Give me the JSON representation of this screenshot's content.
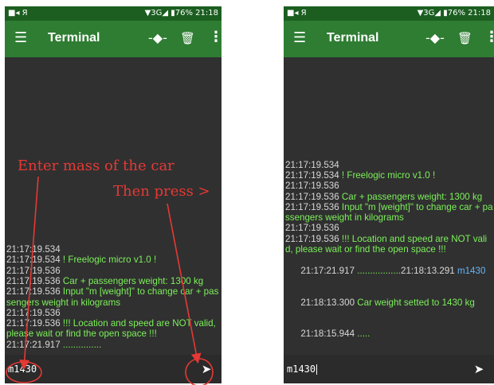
{
  "left": {
    "status_left": "■◂  Я",
    "status_right": "▼3G◢ ▮76% 21:18",
    "title": "Terminal",
    "log": [
      {
        "ts": "21:17:19.534",
        "msg": ""
      },
      {
        "ts": "21:17:19.534",
        "msg": " ! Freelogic micro v1.0 !"
      },
      {
        "ts": "21:17:19.536",
        "msg": ""
      },
      {
        "ts": "21:17:19.536",
        "msg": " Car + passengers weight: 1300 kg"
      },
      {
        "ts": "21:17:19.536",
        "msg": " Input \"m [weight]\" to change car + passengers weight in kilograms"
      },
      {
        "ts": "21:17:19.536",
        "msg": ""
      },
      {
        "ts": "21:17:19.536",
        "msg": " !!! Location and speed are NOT valid, please wait or find the open space !!!"
      },
      {
        "ts": "21:17:21.917",
        "msg": " ..............."
      }
    ],
    "input_value": "m1430",
    "annotation_1": "Enter mass of the car",
    "annotation_2": "Then press >"
  },
  "right": {
    "status_left": "■◂  Я",
    "status_right": "▼3G◢ ▮76% 21:18",
    "title": "Terminal",
    "log_a": [
      {
        "ts": "21:17:19.534",
        "msg": ""
      },
      {
        "ts": "21:17:19.534",
        "msg": " ! Freelogic micro v1.0 !"
      },
      {
        "ts": "21:17:19.536",
        "msg": ""
      },
      {
        "ts": "21:17:19.536",
        "msg": " Car + passengers weight: 1300 kg"
      },
      {
        "ts": "21:17:19.536",
        "msg": " Input \"m [weight]\" to change car + passengers weight in kilograms"
      },
      {
        "ts": "21:17:19.536",
        "msg": ""
      },
      {
        "ts": "21:17:19.536",
        "msg": " !!! Location and speed are NOT valid, please wait or find the open space !!!"
      }
    ],
    "line_progress": {
      "ts": "21:17:21.917",
      "dots": " .................",
      "ts2": "21:18:13.291",
      "echo": " m1430"
    },
    "line_setted": {
      "ts": "21:18:13.300",
      "msg": " Car weight setted to 1430 kg"
    },
    "line_last": {
      "ts": "21:18:15.944",
      "msg": " ....."
    },
    "input_value": "m1430"
  }
}
